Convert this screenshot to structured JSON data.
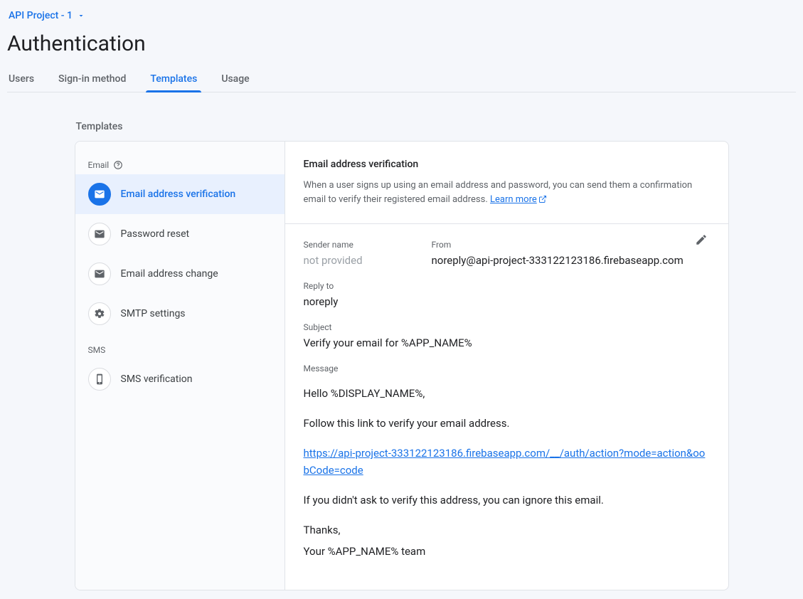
{
  "project": {
    "name": "API Project - 1"
  },
  "pageTitle": "Authentication",
  "tabs": [
    {
      "label": "Users"
    },
    {
      "label": "Sign-in method"
    },
    {
      "label": "Templates"
    },
    {
      "label": "Usage"
    }
  ],
  "sectionTitle": "Templates",
  "sidebar": {
    "emailLabel": "Email",
    "smsLabel": "SMS",
    "items": [
      {
        "label": "Email address verification"
      },
      {
        "label": "Password reset"
      },
      {
        "label": "Email address change"
      },
      {
        "label": "SMTP settings"
      },
      {
        "label": "SMS verification"
      }
    ]
  },
  "detail": {
    "title": "Email address verification",
    "desc": "When a user signs up using an email address and password, you can send them a confirmation email to verify their registered email address.",
    "learnMore": "Learn more",
    "senderLabel": "Sender name",
    "senderValue": "not provided",
    "fromLabel": "From",
    "fromValue": "noreply@api-project-333122123186.firebaseapp.com",
    "replyToLabel": "Reply to",
    "replyToValue": "noreply",
    "subjectLabel": "Subject",
    "subjectValue": "Verify your email for %APP_NAME%",
    "messageLabel": "Message",
    "message": {
      "greeting": "Hello %DISPLAY_NAME%,",
      "line1": "Follow this link to verify your email address.",
      "link": "https://api-project-333122123186.firebaseapp.com/__/auth/action?mode=action&oobCode=code",
      "line2": "If you didn't ask to verify this address, you can ignore this email.",
      "thanks": "Thanks,",
      "signoff": "Your %APP_NAME% team"
    }
  }
}
